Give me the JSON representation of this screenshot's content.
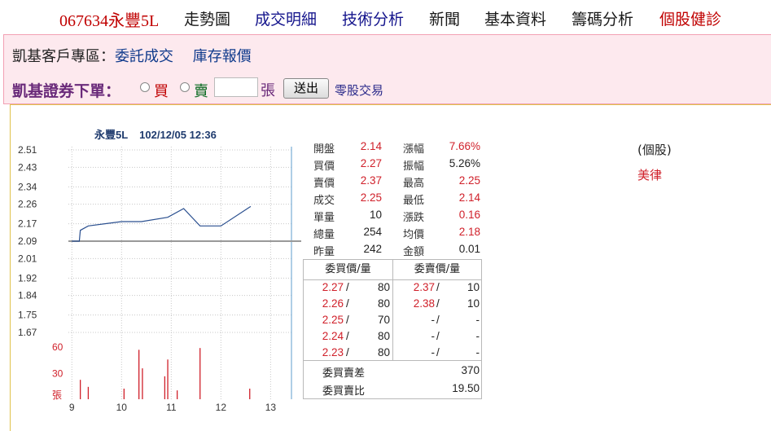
{
  "nav": {
    "title": "067634永豐5L",
    "items": [
      {
        "label": "走勢圖",
        "color": "black"
      },
      {
        "label": "成交明細",
        "color": "blue"
      },
      {
        "label": "技術分析",
        "color": "blue"
      },
      {
        "label": "新聞",
        "color": "black"
      },
      {
        "label": "基本資料",
        "color": "black"
      },
      {
        "label": "籌碼分析",
        "color": "black"
      },
      {
        "label": "個股健診",
        "color": "red"
      }
    ]
  },
  "broker": {
    "zone_label": "凱基客戶專區：",
    "link1": "委託成交",
    "link2": "庫存報價",
    "order_title": "凱基證券下單：",
    "buy_label": "買",
    "sell_label": "賣",
    "qty_value": "",
    "unit": "張",
    "submit_label": "送出",
    "odd_lot_link": "零股交易"
  },
  "chart_header": {
    "name": "永豐5L",
    "datetime": "102/12/05 12:36"
  },
  "chart_data": {
    "type": "line",
    "title": "永豐5L 102/12/05 12:36",
    "x_ticks": [
      "9",
      "10",
      "11",
      "12",
      "13"
    ],
    "y_ticks": [
      "2.51",
      "2.43",
      "2.34",
      "2.26",
      "2.17",
      "2.09",
      "2.01",
      "1.92",
      "1.84",
      "1.75",
      "1.67"
    ],
    "ylim": [
      1.67,
      2.51
    ],
    "reference_price": 2.09,
    "price_series": {
      "x": [
        9.0,
        9.15,
        9.17,
        9.33,
        10.0,
        10.4,
        10.93,
        11.25,
        11.58,
        12.0,
        12.6
      ],
      "y": [
        2.09,
        2.09,
        2.14,
        2.16,
        2.18,
        2.18,
        2.2,
        2.24,
        2.16,
        2.16,
        2.25
      ]
    },
    "volume_ticks": [
      "60",
      "30",
      "張"
    ],
    "volume_max": 60,
    "volume_series": {
      "x": [
        9.17,
        9.33,
        10.05,
        10.35,
        10.42,
        10.87,
        10.93,
        11.12,
        11.58,
        12.58
      ],
      "y": [
        22,
        14,
        12,
        56,
        35,
        26,
        45,
        10,
        58,
        12
      ]
    },
    "grid": true
  },
  "quote": {
    "rows": [
      {
        "l1": "開盤",
        "v1": "2.14",
        "l2": "漲幅",
        "v2": "7.66%",
        "c2": "red"
      },
      {
        "l1": "買價",
        "v1": "2.27",
        "l2": "振幅",
        "v2": "5.26%",
        "c2": "black"
      },
      {
        "l1": "賣價",
        "v1": "2.37",
        "l2": "最高",
        "v2": "2.25",
        "c2": "red"
      },
      {
        "l1": "成交",
        "v1": "2.25",
        "l2": "最低",
        "v2": "2.14",
        "c2": "red"
      },
      {
        "l1": "單量",
        "v1": "10",
        "l2": "漲跌",
        "v2": "0.16",
        "c2": "red"
      },
      {
        "l1": "總量",
        "v1": "254",
        "l2": "均價",
        "v2": "2.18",
        "c2": "red"
      },
      {
        "l1": "昨量",
        "v1": "242",
        "l2": "金額",
        "v2": "0.01",
        "c2": "black"
      }
    ],
    "v1_colors": [
      "red",
      "red",
      "red",
      "red",
      "black",
      "black",
      "black"
    ]
  },
  "orderbook": {
    "buy_header": "委買價/量",
    "sell_header": "委賣價/量",
    "rows": [
      {
        "bp": "2.27",
        "bq": "80",
        "sp": "2.37",
        "sq": "10",
        "sred": true
      },
      {
        "bp": "2.26",
        "bq": "80",
        "sp": "2.38",
        "sq": "10",
        "sred": true
      },
      {
        "bp": "2.25",
        "bq": "70",
        "sp": "-",
        "sq": "-",
        "sred": false
      },
      {
        "bp": "2.24",
        "bq": "80",
        "sp": "-",
        "sq": "-",
        "sred": false
      },
      {
        "bp": "2.23",
        "bq": "80",
        "sp": "-",
        "sq": "-",
        "sred": false
      }
    ],
    "diff_label": "委買賣差",
    "diff_value": "370",
    "ratio_label": "委買賣比",
    "ratio_value": "19.50"
  },
  "side": {
    "label": "(個股)",
    "link": "美律"
  },
  "colors": {
    "accent_red": "#d0202a",
    "line_blue": "#2a4f8f",
    "volume_red": "#d0202a",
    "pink_bg": "#fde9ee"
  }
}
